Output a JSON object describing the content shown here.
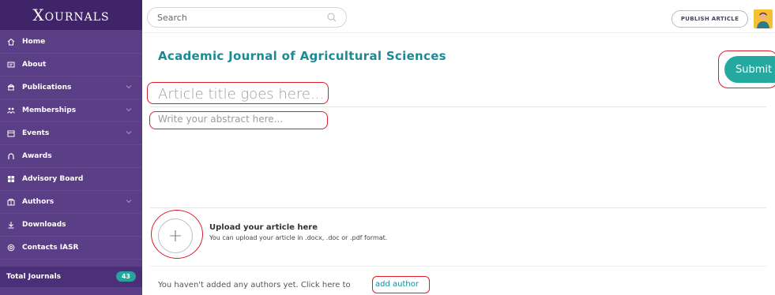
{
  "app": {
    "logo": "Xournals"
  },
  "sidebar": {
    "items": [
      {
        "label": "Home",
        "icon": "home-icon",
        "has_chevron": false
      },
      {
        "label": "About",
        "icon": "info-card-icon",
        "has_chevron": false
      },
      {
        "label": "Publications",
        "icon": "publications-icon",
        "has_chevron": true
      },
      {
        "label": "Memberships",
        "icon": "memberships-icon",
        "has_chevron": true
      },
      {
        "label": "Events",
        "icon": "calendar-icon",
        "has_chevron": true
      },
      {
        "label": "Awards",
        "icon": "award-icon",
        "has_chevron": false
      },
      {
        "label": "Advisory Board",
        "icon": "advisory-board-icon",
        "has_chevron": false
      },
      {
        "label": "Authors",
        "icon": "authors-icon",
        "has_chevron": true
      },
      {
        "label": "Downloads",
        "icon": "download-icon",
        "has_chevron": false
      },
      {
        "label": "Contacts IASR",
        "icon": "contacts-icon",
        "has_chevron": false
      }
    ],
    "total_label": "Total Journals",
    "total_count": "43"
  },
  "topbar": {
    "search_placeholder": "Search",
    "publish_label": "PUBLISH ARTICLE"
  },
  "main": {
    "journal_title": "Academic Journal of Agricultural Sciences",
    "submit_label": "Submit",
    "title_placeholder": "Article title goes here...",
    "abstract_placeholder": "Write your abstract here...",
    "upload_title": "Upload your article here",
    "upload_desc": "You can upload your article in .docx, .doc or .pdf format.",
    "authors_text": "You haven't added any authors yet. Click here to",
    "add_author_label": "add author"
  },
  "colors": {
    "sidebar_bg": "#5b3f86",
    "logo_bg": "#3f2468",
    "accent": "#23a9a0",
    "highlight": "#d91d2b"
  }
}
